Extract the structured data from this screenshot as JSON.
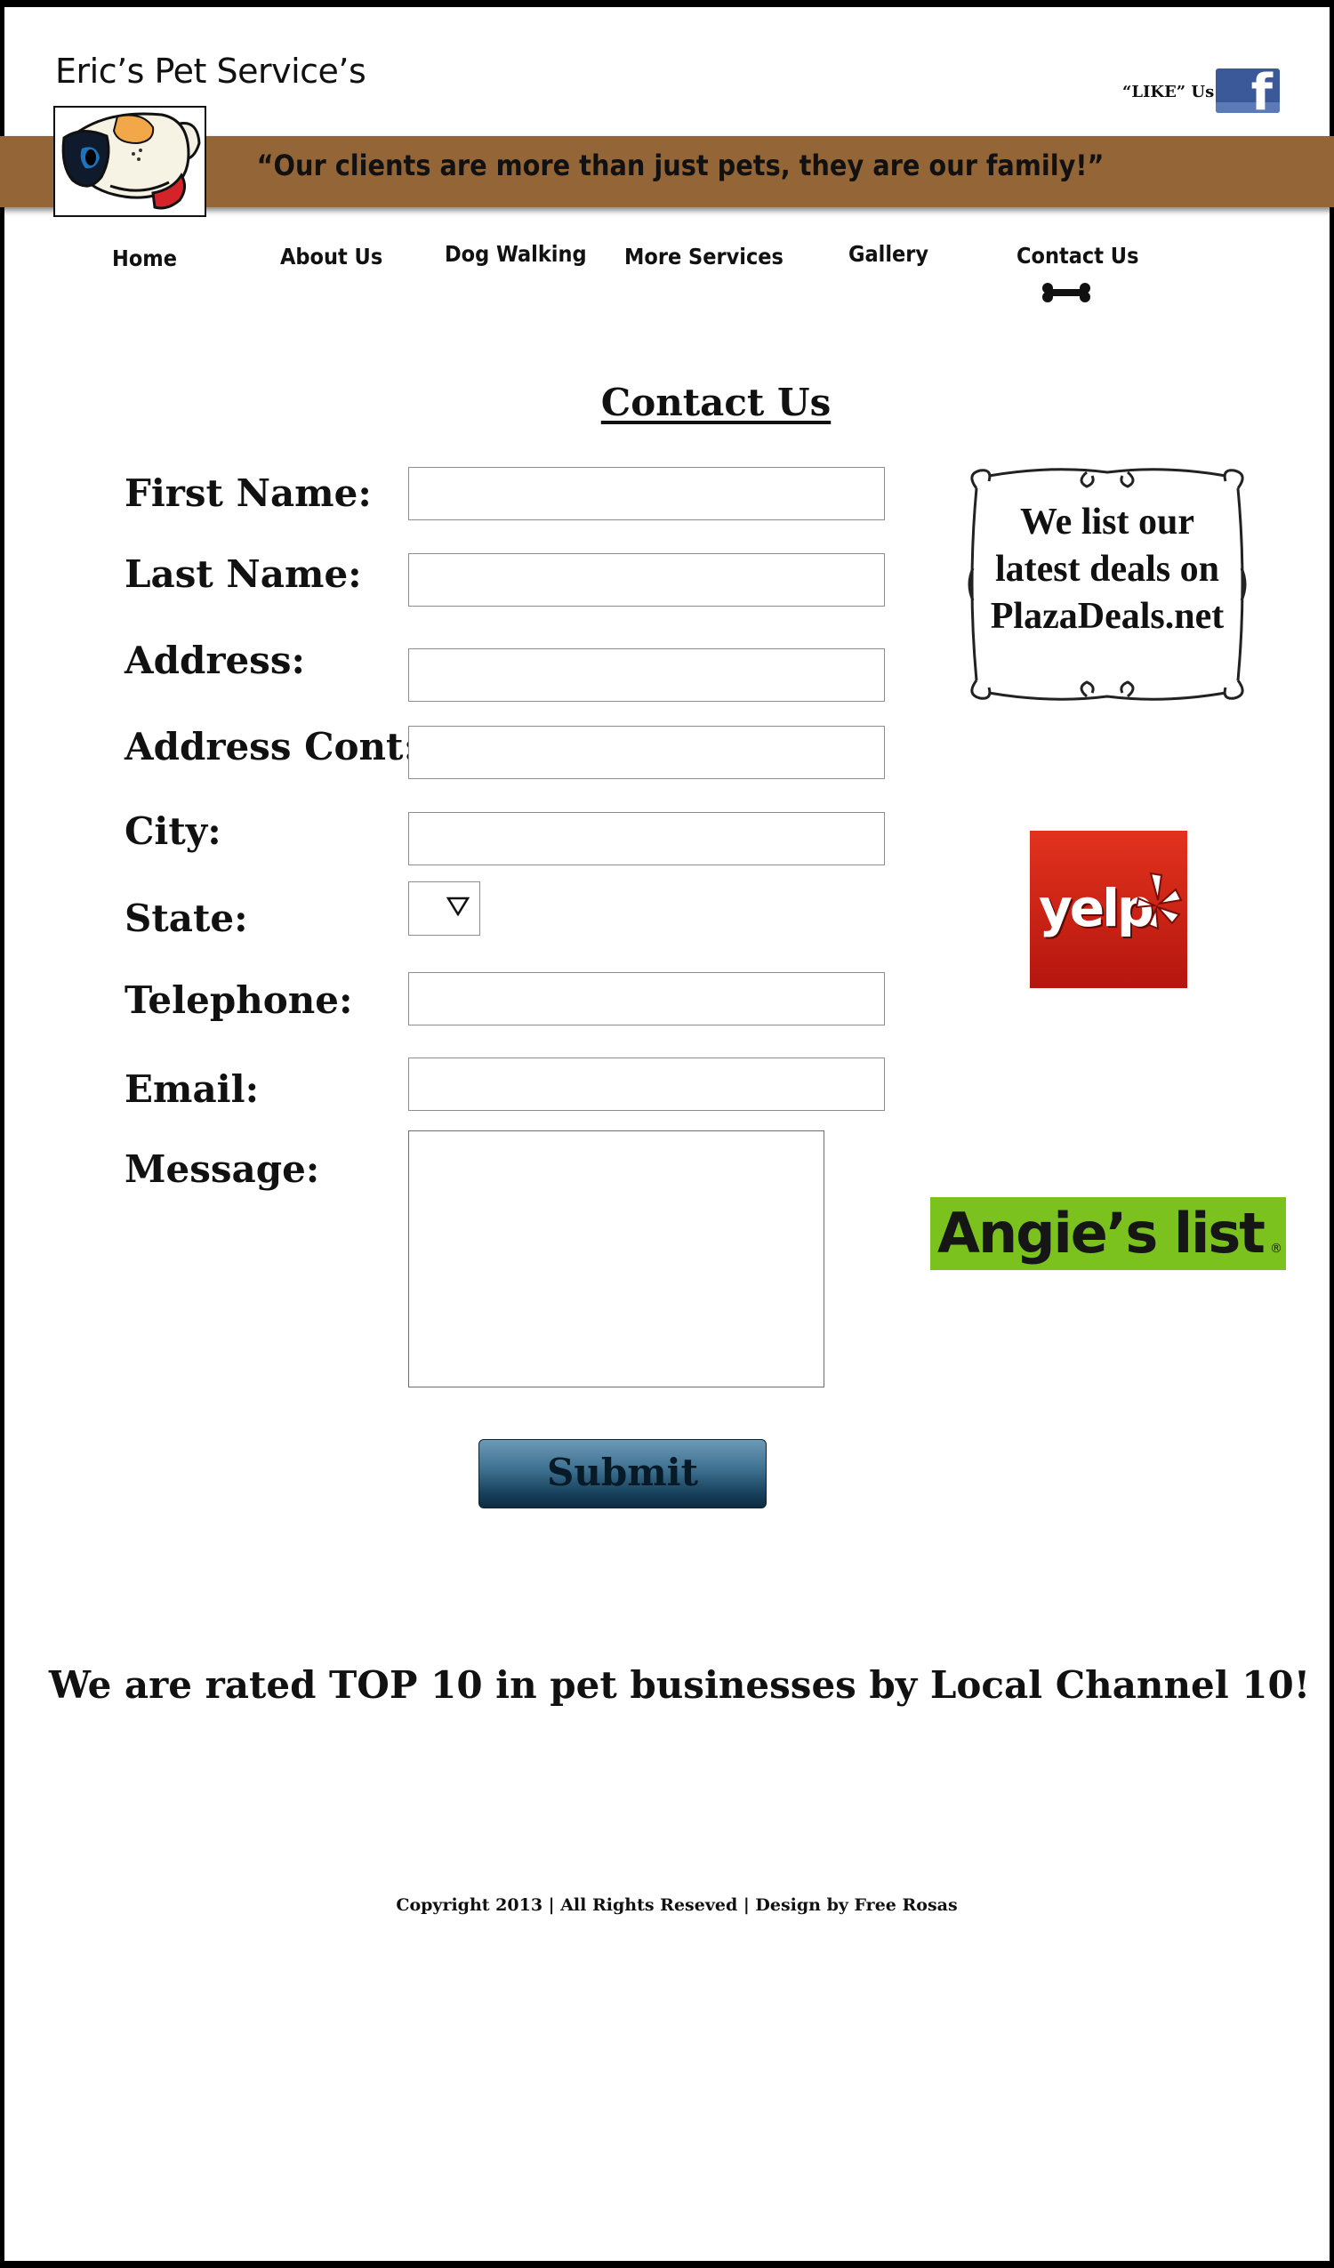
{
  "header": {
    "site_title": "Eric’s Pet Service’s",
    "like_label": "“LIKE”  Us",
    "facebook_icon": "facebook-f-icon",
    "tagline": "“Our clients are more than just pets, they are our family!”",
    "logo": "dog-face-logo",
    "banner_color": "#946637"
  },
  "nav": {
    "items": [
      {
        "label": "Home"
      },
      {
        "label": "About Us"
      },
      {
        "label": "Dog Walking"
      },
      {
        "label": "More Services"
      },
      {
        "label": "Gallery"
      },
      {
        "label": "Contact Us"
      }
    ],
    "active": "Contact Us",
    "active_indicator_icon": "bone-icon"
  },
  "form": {
    "heading": "Contact Us",
    "first_name": {
      "label": "First Name:",
      "value": ""
    },
    "last_name": {
      "label": "Last Name:",
      "value": ""
    },
    "address": {
      "label": "Address:",
      "value": ""
    },
    "address_cont": {
      "label": "Address Cont:",
      "value": ""
    },
    "city": {
      "label": "City:",
      "value": ""
    },
    "state": {
      "label": "State:",
      "value": ""
    },
    "telephone": {
      "label": "Telephone:",
      "value": ""
    },
    "email": {
      "label": "Email:",
      "value": ""
    },
    "message": {
      "label": "Message:",
      "value": ""
    },
    "submit_label": "Submit",
    "submit_color": "#2f5f7e"
  },
  "sidebar": {
    "deals": {
      "line1": "We list our",
      "line2": "latest deals on",
      "line3": "PlazaDeals.net"
    },
    "yelp": {
      "text": "yelp",
      "color": "#d32323"
    },
    "angies": {
      "text": "Angie’s list",
      "color": "#7cc21e"
    }
  },
  "rating_text": "We are rated TOP 10 in pet businesses by Local Channel 10!",
  "footer": "Copyright 2013 |  All Rights Reseved | Design by Free Rosas"
}
